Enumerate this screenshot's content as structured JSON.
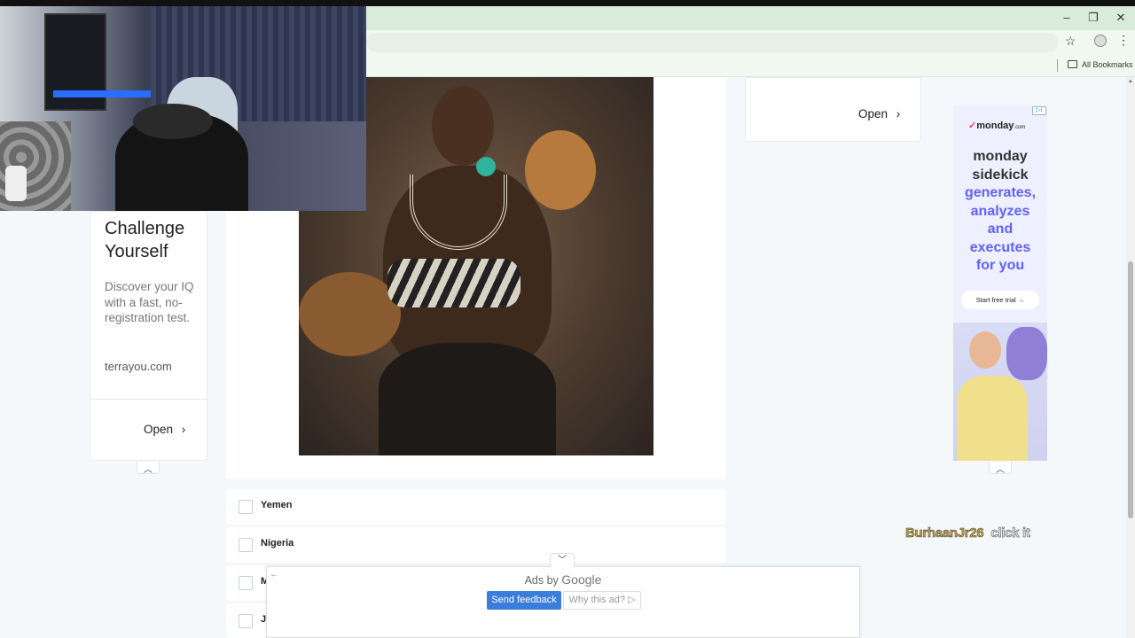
{
  "browser": {
    "bookmarks_label": "All Bookmarks",
    "window_controls": [
      "–",
      "❐",
      "✕"
    ]
  },
  "left_ad": {
    "title_line1": "Challenge",
    "title_line2": "Yourself",
    "body": "Discover your IQ with a fast, no-registration test.",
    "domain": "terrayou.com",
    "cta": "Open"
  },
  "top_ad": {
    "cta": "Open"
  },
  "right_ad": {
    "brand": "monday",
    "brand_suffix": ".com",
    "line1": "monday",
    "line2": "sidekick",
    "line3": "generates,",
    "line4": "analyzes",
    "line5": "and",
    "line6": "executes",
    "line7": "for you",
    "cta": "Start free trial →"
  },
  "quiz": {
    "options": [
      "Yemen",
      "Nigeria",
      "M",
      "J"
    ]
  },
  "ad_bar": {
    "ads_by": "Ads by",
    "google": "Google",
    "send_feedback": "Send feedback",
    "why_this_ad": "Why this ad? ▷"
  },
  "overlay": {
    "user": "BurhaanJr26",
    "message": "click it"
  },
  "colors": {
    "accent_blue": "#3b7ddd",
    "monday_blue": "#6161ff"
  }
}
